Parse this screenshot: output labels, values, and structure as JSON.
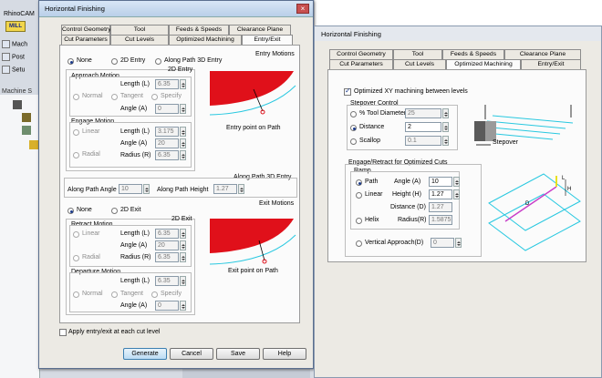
{
  "app": {
    "title": "RhinoCAM",
    "mill": "MILL",
    "side_items": [
      {
        "label": "Mach"
      },
      {
        "label": "Post"
      },
      {
        "label": "Setu"
      }
    ],
    "section": "Machine S"
  },
  "dialog1": {
    "title": "Horizontal Finishing",
    "tabs_row1": [
      "Control Geometry",
      "Tool",
      "Feeds & Speeds",
      "Clearance Plane"
    ],
    "tabs_row2": [
      "Cut Parameters",
      "Cut Levels",
      "Optimized Machining",
      "Entry/Exit"
    ],
    "entry_motions": {
      "title": "Entry Motions",
      "options": [
        "None",
        "2D Entry",
        "Along Path 3D Entry"
      ],
      "selected": "None",
      "twod_title": "2D Entry",
      "approach": {
        "title": "Approach Motion",
        "length_label": "Length (L)",
        "length": "6.35",
        "modes": [
          "Normal",
          "Tangent",
          "Specify"
        ],
        "angle_label": "Angle (A)",
        "angle": "0"
      },
      "engage": {
        "title": "Engage Motion",
        "modes": [
          "Linear",
          "Radial"
        ],
        "length_label": "Length (L)",
        "length": "3.175",
        "angle_label": "Angle (A)",
        "angle": "20",
        "radius_label": "Radius (R)",
        "radius": "6.35"
      },
      "preview_caption": "Entry point on Path"
    },
    "along_path": {
      "title": "Along Path 3D Entry",
      "angle_label": "Along Path Angle",
      "angle": "10",
      "height_label": "Along Path Height",
      "height": "1.27"
    },
    "exit_motions": {
      "title": "Exit Motions",
      "options": [
        "None",
        "2D Exit"
      ],
      "selected": "None",
      "twod_title": "2D Exit",
      "retract": {
        "title": "Retract Motion",
        "modes": [
          "Linear",
          "Radial"
        ],
        "length_label": "Length (L)",
        "length": "6.35",
        "angle_label": "Angle (A)",
        "angle": "20",
        "radius_label": "Radius (R)",
        "radius": "6.35"
      },
      "departure": {
        "title": "Departure Motion",
        "length_label": "Length (L)",
        "length": "6.35",
        "modes": [
          "Normal",
          "Tangent",
          "Specify"
        ],
        "angle_label": "Angle (A)",
        "angle": "0"
      },
      "preview_caption": "Exit point on Path"
    },
    "apply_label": "Apply entry/exit at each cut level",
    "buttons": [
      "Generate",
      "Cancel",
      "Save",
      "Help"
    ]
  },
  "dialog2": {
    "title": "Horizontal Finishing",
    "tabs_row1": [
      "Control Geometry",
      "Tool",
      "Feeds & Speeds",
      "Clearance Plane"
    ],
    "tabs_row2": [
      "Cut Parameters",
      "Cut Levels",
      "Optimized Machining",
      "Entry/Exit"
    ],
    "optimized_label": "Optimized XY machining between levels",
    "stepover": {
      "title": "Stepover Control",
      "options": [
        {
          "label": "% Tool Diameter",
          "value": "25"
        },
        {
          "label": "Distance",
          "value": "2"
        },
        {
          "label": "Scallop",
          "value": "0.1"
        }
      ],
      "selected": "Distance",
      "caption": "Stepover"
    },
    "engage": {
      "title": "Engage/Retract for Optimized Cuts",
      "ramp": "Ramp",
      "path_label": "Path",
      "angle_label": "Angle (A)",
      "angle": "10",
      "linear_label": "Linear",
      "height_label": "Height (H)",
      "height": "1.27",
      "distance_label": "Distance (D)",
      "distance": "1.27",
      "helix_label": "Helix",
      "radius_label": "Radius(R)",
      "radius": "1.5875",
      "vertical_label": "Vertical Approach(D)",
      "vertical": "0",
      "diagram_labels": {
        "L": "L",
        "H": "H",
        "D": "D"
      }
    }
  },
  "colors": {
    "preview_fill": "#e0101a",
    "path_line": "#28c8e0",
    "title_bar": "#c4d6ec"
  }
}
